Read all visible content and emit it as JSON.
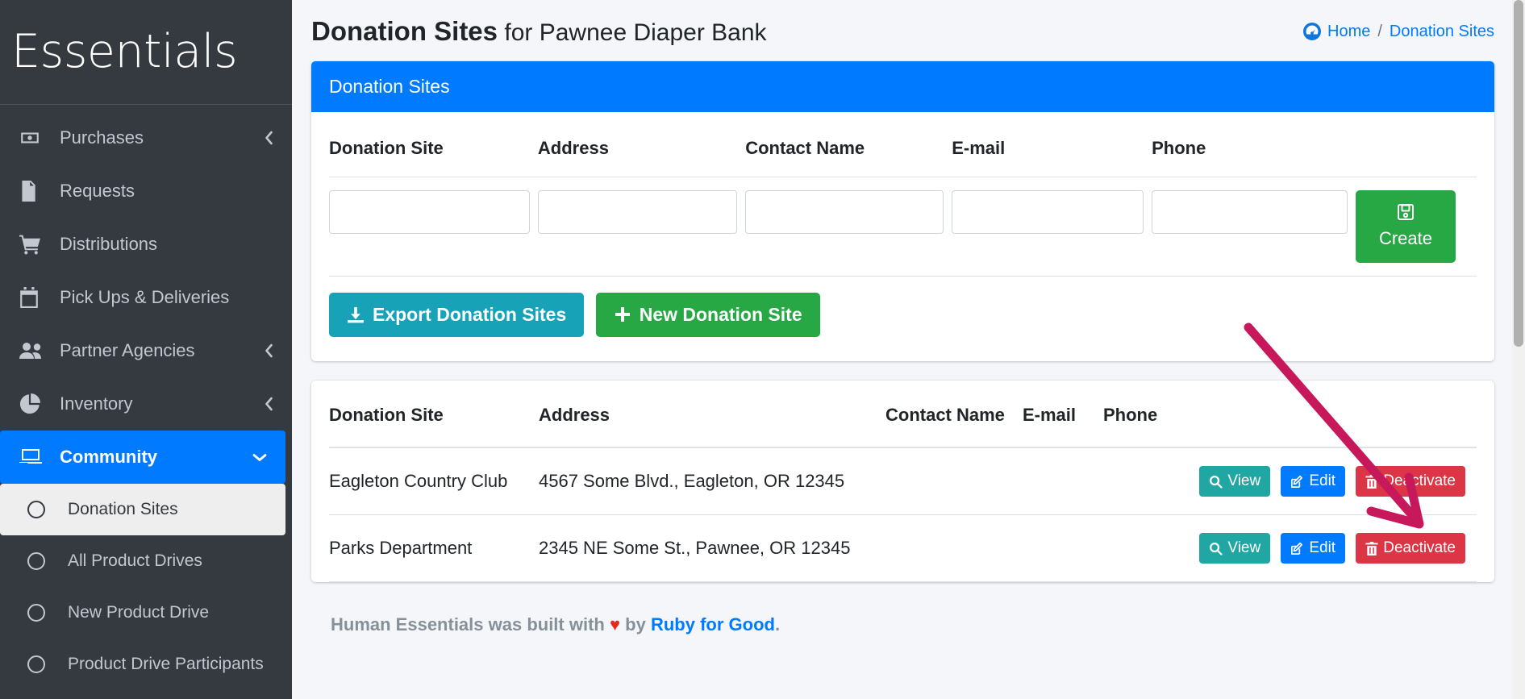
{
  "brand": {
    "name": "Essentials"
  },
  "sidebar": {
    "items": [
      {
        "label": "Purchases",
        "icon": "money-bill-icon",
        "chevron": "chevron-left",
        "active": false
      },
      {
        "label": "Requests",
        "icon": "file-alt-icon",
        "chevron": "",
        "active": false
      },
      {
        "label": "Distributions",
        "icon": "shopping-cart-icon",
        "chevron": "",
        "active": false
      },
      {
        "label": "Pick Ups & Deliveries",
        "icon": "calendar-icon",
        "chevron": "",
        "active": false
      },
      {
        "label": "Partner Agencies",
        "icon": "users-icon",
        "chevron": "chevron-left",
        "active": false
      },
      {
        "label": "Inventory",
        "icon": "chart-pie-icon",
        "chevron": "chevron-left",
        "active": false
      },
      {
        "label": "Community",
        "icon": "laptop-icon",
        "chevron": "chevron-down",
        "active": true
      }
    ],
    "subitems": [
      {
        "label": "Donation Sites",
        "icon": "circle-icon",
        "current": true
      },
      {
        "label": "All Product Drives",
        "icon": "circle-icon",
        "current": false
      },
      {
        "label": "New Product Drive",
        "icon": "circle-icon",
        "current": false
      },
      {
        "label": "Product Drive Participants",
        "icon": "circle-icon",
        "current": false
      }
    ]
  },
  "header": {
    "title_bold": "Donation Sites",
    "title_rest": " for Pawnee Diaper Bank",
    "breadcrumb": {
      "home": "Home",
      "separator": "/",
      "current": "Donation Sites"
    }
  },
  "form_card": {
    "title": "Donation Sites",
    "columns": [
      "Donation Site",
      "Address",
      "Contact Name",
      "E-mail",
      "Phone"
    ],
    "inputs": [
      {
        "name": "donation-site",
        "value": "",
        "placeholder": ""
      },
      {
        "name": "address",
        "value": "",
        "placeholder": ""
      },
      {
        "name": "contact-name",
        "value": "",
        "placeholder": ""
      },
      {
        "name": "email",
        "value": "",
        "placeholder": ""
      },
      {
        "name": "phone",
        "value": "",
        "placeholder": ""
      }
    ],
    "create_label": "Create",
    "create_icon": "save-icon"
  },
  "actions": {
    "export_label": "Export Donation Sites",
    "export_icon": "download-icon",
    "new_label": "New Donation Site",
    "new_icon": "plus-icon"
  },
  "table": {
    "columns": [
      "Donation Site",
      "Address",
      "Contact Name",
      "E-mail",
      "Phone",
      ""
    ],
    "row_buttons": {
      "view": "View",
      "edit": "Edit",
      "deactivate": "Deactivate"
    },
    "rows": [
      {
        "site": "Eagleton Country Club",
        "address": "4567 Some Blvd., Eagleton, OR 12345",
        "contact_name": "",
        "email": "",
        "phone": ""
      },
      {
        "site": "Parks Department",
        "address": "2345 NE Some St., Pawnee, OR 12345",
        "contact_name": "",
        "email": "",
        "phone": ""
      }
    ]
  },
  "footer": {
    "prefix": "Human Essentials was built with",
    "heart": "♥",
    "middle": "by",
    "link": "Ruby for Good",
    "suffix": "."
  },
  "annotation": {
    "type": "arrow",
    "color": "#c7185c",
    "points_to": "deactivate-button-row-1"
  },
  "colors": {
    "sidebar_bg": "#343a40",
    "accent_blue": "#007bff",
    "success_green": "#28a745",
    "info_teal": "#17a2b8",
    "danger_red": "#dc3545",
    "view_teal": "#20a7a4",
    "annotation": "#c7185c"
  }
}
